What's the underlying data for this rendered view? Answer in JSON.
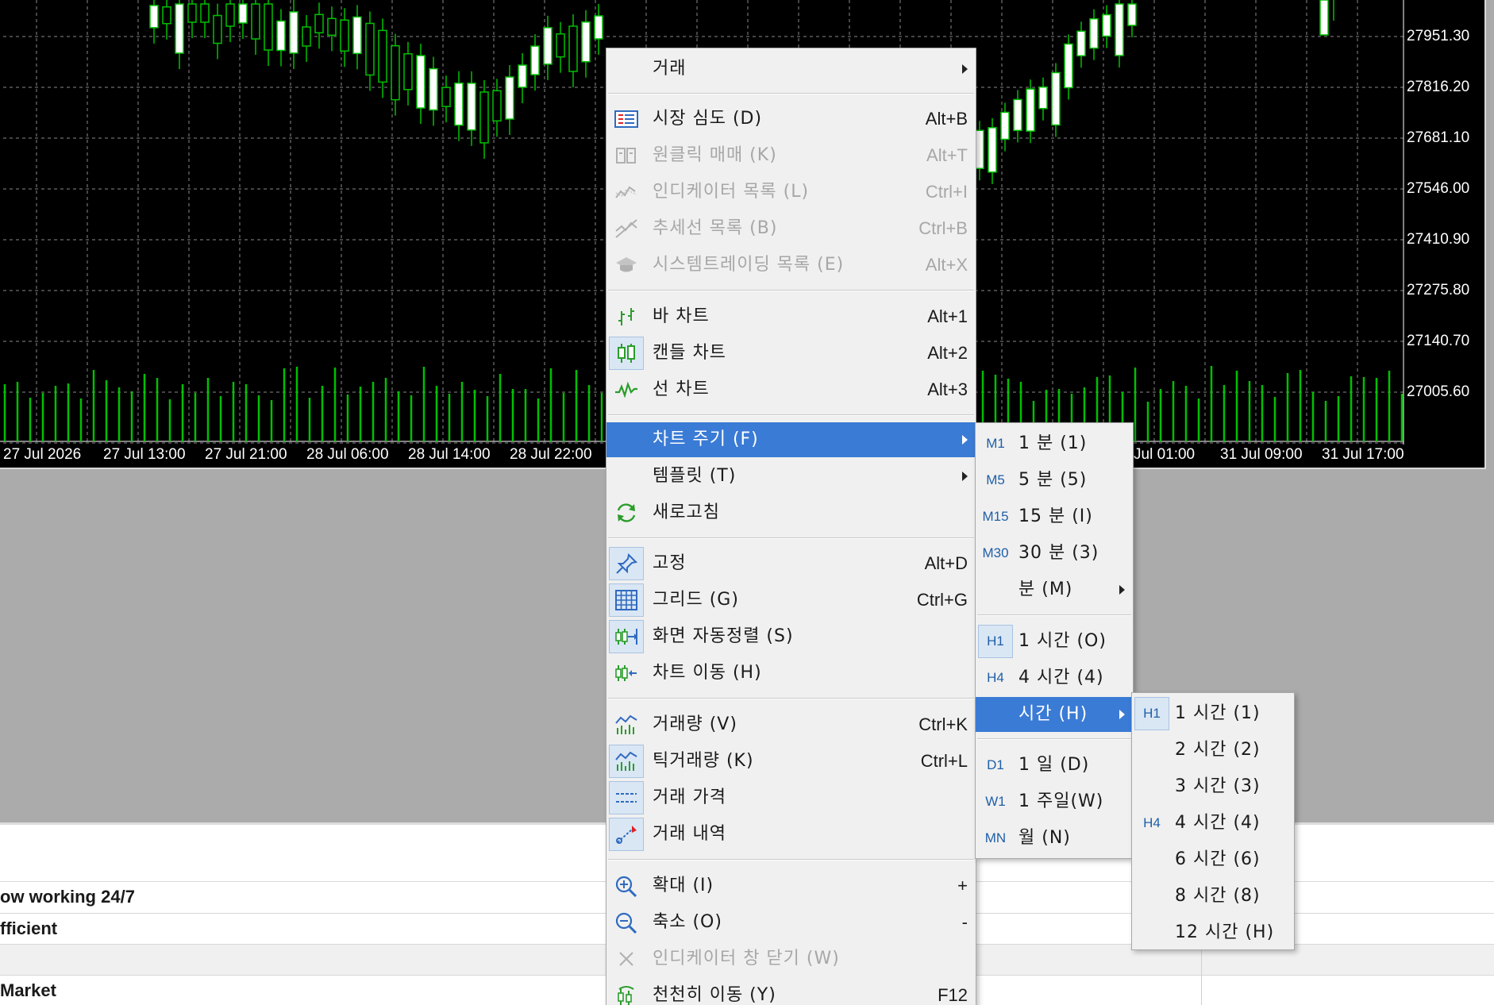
{
  "colors": {
    "chart_bg": "#000000",
    "bull": "#ffffff",
    "line": "#00c000",
    "grid": "#8a8a8a",
    "menu_bg": "#f0f0f0",
    "highlight": "#3a7bd5",
    "tf_text": "#1f5fa8"
  },
  "chart": {
    "price_labels": [
      "27951.30",
      "27816.20",
      "27681.10",
      "27546.00",
      "27410.90",
      "27275.80",
      "27140.70",
      "27005.60"
    ],
    "time_labels": [
      "27 Jul 2026",
      "27 Jul 13:00",
      "27 Jul 21:00",
      "28 Jul 06:00",
      "28 Jul 14:00",
      "28 Jul 22:00",
      "Jul 01:00",
      "31 Jul 09:00",
      "31 Jul 17:00"
    ]
  },
  "bottom_panel": {
    "rows": [
      "ow working 24/7",
      "fficient",
      "",
      "Market"
    ]
  },
  "context_menu": {
    "items": [
      {
        "label": "거래",
        "shortcut": "",
        "icon": "",
        "submenu": true,
        "disabled": false
      },
      {
        "label": "시장 심도 (D)",
        "shortcut": "Alt+B",
        "icon": "market-depth-icon",
        "disabled": false
      },
      {
        "label": "원클릭 매매 (K)",
        "shortcut": "Alt+T",
        "icon": "one-click-trading-icon",
        "disabled": true
      },
      {
        "label": "인디케이터 목록 (L)",
        "shortcut": "Ctrl+I",
        "icon": "indicator-list-icon",
        "disabled": true
      },
      {
        "label": "추세선 목록 (B)",
        "shortcut": "Ctrl+B",
        "icon": "trendline-list-icon",
        "disabled": true
      },
      {
        "label": "시스템트레이딩 목록 (E)",
        "shortcut": "Alt+X",
        "icon": "expert-list-icon",
        "disabled": true
      },
      {
        "label": "바 차트",
        "shortcut": "Alt+1",
        "icon": "bar-chart-icon",
        "disabled": false
      },
      {
        "label": "캔들 차트",
        "shortcut": "Alt+2",
        "icon": "candlestick-icon",
        "disabled": false
      },
      {
        "label": "선 차트",
        "shortcut": "Alt+3",
        "icon": "line-chart-icon",
        "disabled": false
      },
      {
        "label": "차트 주기 (F)",
        "shortcut": "",
        "icon": "",
        "submenu": true,
        "selected": true
      },
      {
        "label": "템플릿 (T)",
        "shortcut": "",
        "icon": "",
        "submenu": true
      },
      {
        "label": "새로고침",
        "shortcut": "",
        "icon": "refresh-icon"
      },
      {
        "label": "고정",
        "shortcut": "Alt+D",
        "icon": "pin-icon"
      },
      {
        "label": "그리드 (G)",
        "shortcut": "Ctrl+G",
        "icon": "grid-icon"
      },
      {
        "label": "화면 자동정렬 (S)",
        "shortcut": "",
        "icon": "autoscroll-icon"
      },
      {
        "label": "차트 이동 (H)",
        "shortcut": "",
        "icon": "chart-shift-icon"
      },
      {
        "label": "거래량 (V)",
        "shortcut": "Ctrl+K",
        "icon": "volume-icon"
      },
      {
        "label": "틱거래량 (K)",
        "shortcut": "Ctrl+L",
        "icon": "tick-volume-icon"
      },
      {
        "label": "거래 가격",
        "shortcut": "",
        "icon": "trade-levels-icon"
      },
      {
        "label": "거래 내역",
        "shortcut": "",
        "icon": "trade-history-icon"
      },
      {
        "label": "확대 (I)",
        "shortcut": "+",
        "icon": "zoom-in-icon"
      },
      {
        "label": "축소 (O)",
        "shortcut": "-",
        "icon": "zoom-out-icon"
      },
      {
        "label": "인디케이터 창 닫기 (W)",
        "shortcut": "",
        "icon": "close-icon",
        "disabled": true
      },
      {
        "label": "천천히 이동 (Y)",
        "shortcut": "F12",
        "icon": "step-icon"
      }
    ]
  },
  "period_menu": {
    "items": [
      {
        "tag": "M1",
        "label": "1 분 (1)"
      },
      {
        "tag": "M5",
        "label": "5 분 (5)"
      },
      {
        "tag": "M15",
        "label": "15 분 (I)"
      },
      {
        "tag": "M30",
        "label": "30 분 (3)"
      },
      {
        "tag": "",
        "label": "분 (M)",
        "submenu": true
      },
      {
        "tag": "H1",
        "label": "1 시간 (O)",
        "checked": true
      },
      {
        "tag": "H4",
        "label": "4 시간 (4)"
      },
      {
        "tag": "",
        "label": "시간 (H)",
        "submenu": true,
        "selected": true
      },
      {
        "tag": "D1",
        "label": "1 일 (D)"
      },
      {
        "tag": "W1",
        "label": "1 주일(W)"
      },
      {
        "tag": "MN",
        "label": "월 (N)"
      }
    ]
  },
  "hour_menu": {
    "items": [
      {
        "tag": "H1",
        "label": "1 시간 (1)",
        "checked": true
      },
      {
        "tag": "",
        "label": "2 시간 (2)"
      },
      {
        "tag": "",
        "label": "3 시간 (3)"
      },
      {
        "tag": "H4",
        "label": "4 시간 (4)"
      },
      {
        "tag": "",
        "label": "6 시간 (6)"
      },
      {
        "tag": "",
        "label": "8 시간 (8)"
      },
      {
        "tag": "",
        "label": "12 시간 (H)"
      }
    ]
  }
}
